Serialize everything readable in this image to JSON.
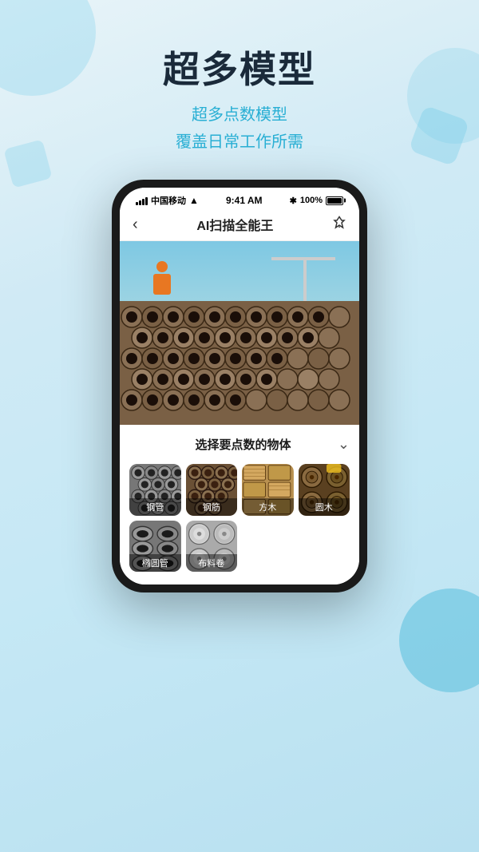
{
  "page": {
    "bg_color": "#d0eaf5",
    "main_title": "超多模型",
    "subtitle_line1": "超多点数模型",
    "subtitle_line2": "覆盖日常工作所需"
  },
  "status_bar": {
    "carrier": "中国移动",
    "time": "9:41 AM",
    "bluetooth": "✱",
    "battery_pct": "100%"
  },
  "app_bar": {
    "back_icon": "‹",
    "title": "AI扫描全能王",
    "pin_icon": "📌"
  },
  "panel": {
    "title": "选择要点数的物体",
    "chevron": "∨"
  },
  "items_row1": [
    {
      "id": "gangguan",
      "label": "钢管",
      "color1": "#aaa",
      "color2": "#555"
    },
    {
      "id": "gangjin",
      "label": "钢筋",
      "color1": "#8a7a5a",
      "color2": "#5a4a2a"
    },
    {
      "id": "fangmu",
      "label": "方木",
      "color1": "#d4a860",
      "color2": "#a07030"
    },
    {
      "id": "yuanmu",
      "label": "圆木",
      "color1": "#8a7a5a",
      "color2": "#4a3820"
    }
  ],
  "items_row2": [
    {
      "id": "tuoyuanguan",
      "label": "椭圆管",
      "color1": "#999",
      "color2": "#666"
    },
    {
      "id": "buliaojuan",
      "label": "布料卷",
      "color1": "#bbb",
      "color2": "#888"
    }
  ]
}
